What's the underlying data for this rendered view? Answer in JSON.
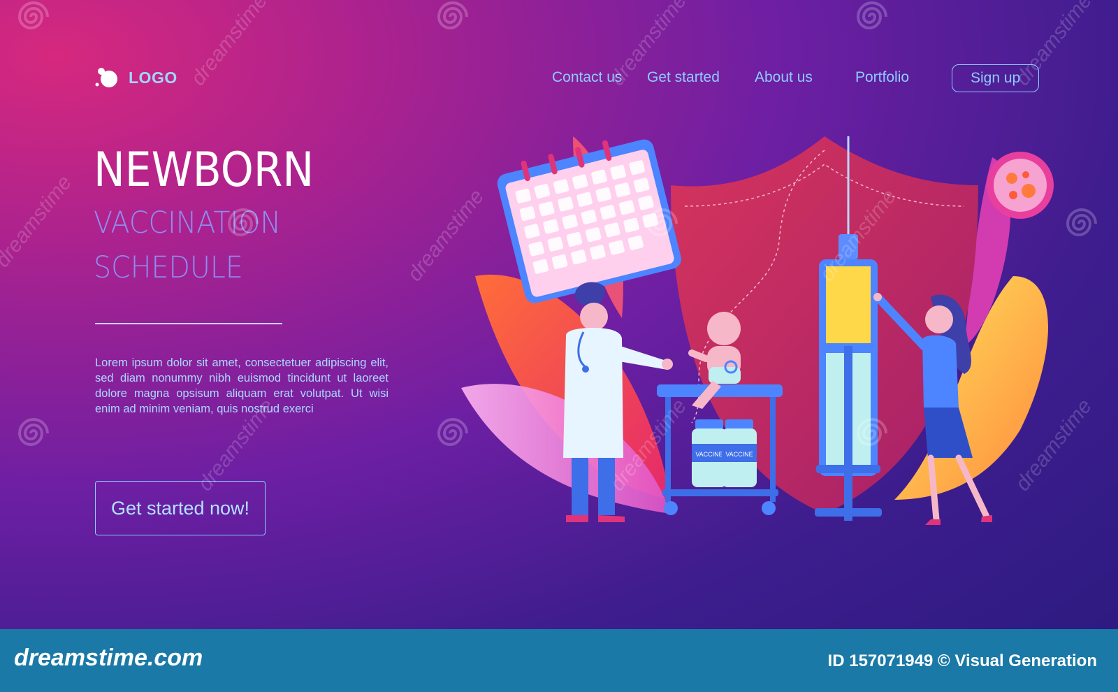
{
  "header": {
    "logo_label": "LOGO",
    "nav": [
      "Contact us",
      "Get started",
      "About us",
      "Portfolio"
    ],
    "signup_label": "Sign up"
  },
  "hero": {
    "title": "NEWBORN",
    "subtitle_line1": "VACCINATION",
    "subtitle_line2": "SCHEDULE",
    "body": "Lorem ipsum dolor sit amet, consectetuer adipiscing elit, sed diam nonummy nibh euismod tincidunt ut laoreet dolore magna opsisum aliquam erat volutpat. Ut wisi enim ad minim veniam, quis nostrud exerci",
    "cta_label": "Get started now!"
  },
  "illustration": {
    "vial_label": "VACCINE"
  },
  "watermark": {
    "text": "dreamstime"
  },
  "footer": {
    "brand": "dreamstime.com",
    "stock_id": "ID 157071949 © Visual Generation"
  },
  "colors": {
    "accent": "#8ecbff",
    "footer_bar": "#1a79a6",
    "title": "#ffffff",
    "subtitle": "#8f8cf0"
  }
}
